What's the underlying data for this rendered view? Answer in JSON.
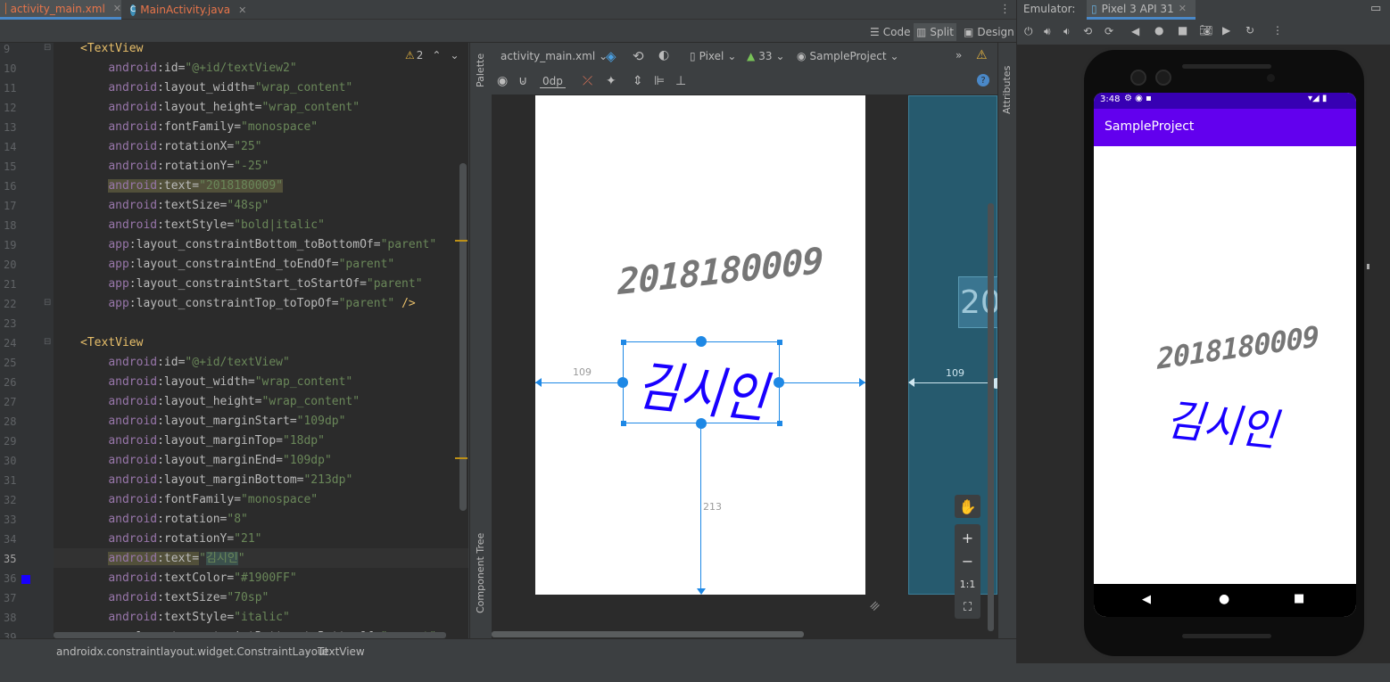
{
  "tabs": [
    {
      "label": "activity_main.xml",
      "active": true,
      "icon": "xml-file-icon"
    },
    {
      "label": "MainActivity.java",
      "active": false,
      "icon": "java-class-icon"
    }
  ],
  "view_modes": {
    "code": "Code",
    "split": "Split",
    "design": "Design"
  },
  "editor": {
    "line_numbers": [
      "9",
      "10",
      "11",
      "12",
      "13",
      "14",
      "15",
      "16",
      "17",
      "18",
      "19",
      "20",
      "21",
      "22",
      "23",
      "24",
      "25",
      "26",
      "27",
      "28",
      "29",
      "30",
      "31",
      "32",
      "33",
      "34",
      "35",
      "36",
      "37",
      "38",
      "39"
    ],
    "warning_count": "2"
  },
  "design_toolbar": {
    "file": "activity_main.xml",
    "device": "Pixel",
    "api": "33",
    "theme": "SampleProject",
    "margin": "0dp"
  },
  "side_panels": {
    "palette": "Palette",
    "component_tree": "Component Tree",
    "attributes": "Attributes"
  },
  "preview": {
    "textview2_text": "2018180009",
    "textview_text": "김시인",
    "margin_start": "109",
    "margin_bottom": "213",
    "blueprint_text": "20",
    "blueprint_margin": "109",
    "text_color": "#1900FF"
  },
  "zoom_controls": {
    "one_to_one": "1:1"
  },
  "breadcrumb": [
    "androidx.constraintlayout.widget.ConstraintLayout",
    "TextView"
  ],
  "emulator": {
    "label": "Emulator:",
    "device_tab": "Pixel 3 API 31",
    "time": "3:48",
    "app_title": "SampleProject",
    "text1": "2018180009",
    "text2": "김시인",
    "app_bar_color": "#6200ee"
  }
}
